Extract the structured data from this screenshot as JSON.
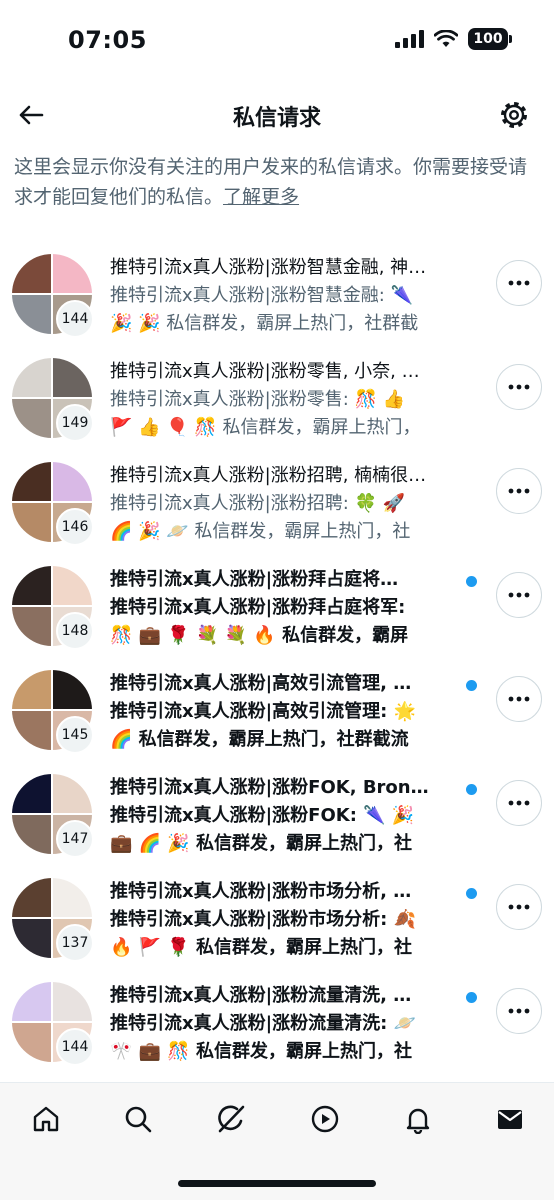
{
  "status": {
    "time": "07:05",
    "battery": "100"
  },
  "header": {
    "title": "私信请求"
  },
  "notice": {
    "text": "这里会显示你没有关注的用户发来的私信请求。你需要接受请求才能回复他们的私信。",
    "link": "了解更多"
  },
  "requests": [
    {
      "name": "推特引流x真人涨粉|涨粉智慧金融, 神…",
      "line2": "推特引流x真人涨粉|涨粉智慧金融: 🌂",
      "line3": "🎉 🎉 私信群发，霸屏上热门，社群截",
      "count": "144",
      "unread": false,
      "avatar_colors": [
        "#7b4a3a",
        "#f4b7c5",
        "#8a8f96",
        "#a89a8c"
      ]
    },
    {
      "name": "推特引流x真人涨粉|涨粉零售, 小奈, …",
      "line2": "推特引流x真人涨粉|涨粉零售: 🎊 👍",
      "line3": "🚩 👍 🎈 🎊 私信群发，霸屏上热门，",
      "count": "149",
      "unread": false,
      "avatar_colors": [
        "#d8d4cf",
        "#6b6460",
        "#9c9188",
        "#c9c2b8"
      ]
    },
    {
      "name": "推特引流x真人涨粉|涨粉招聘, 楠楠很…",
      "line2": "推特引流x真人涨粉|涨粉招聘: 🍀 🚀",
      "line3": "🌈 🎉 🪐 私信群发，霸屏上热门，社",
      "count": "146",
      "unread": false,
      "avatar_colors": [
        "#4a2e22",
        "#d9b9e6",
        "#b58a66",
        "#c7a98f"
      ]
    },
    {
      "name": "推特引流x真人涨粉|涨粉拜占庭将…",
      "line2": "推特引流x真人涨粉|涨粉拜占庭将军:",
      "line3": "🎊 💼 🌹 💐 💐 🔥 私信群发，霸屏",
      "count": "148",
      "unread": true,
      "avatar_colors": [
        "#2b2220",
        "#f1d7c9",
        "#8a6f60",
        "#e9dcd3"
      ]
    },
    {
      "name": "推特引流x真人涨粉|高效引流管理, …",
      "line2": "推特引流x真人涨粉|高效引流管理: 🌟",
      "line3": "🌈 私信群发，霸屏上热门，社群截流",
      "count": "145",
      "unread": true,
      "avatar_colors": [
        "#c79a6b",
        "#1e1a19",
        "#9b7660",
        "#d9b8a6"
      ]
    },
    {
      "name": "推特引流x真人涨粉|涨粉FOK, Bron…",
      "line2": "推特引流x真人涨粉|涨粉FOK: 🌂 🎉",
      "line3": "💼 🌈 🎉 私信群发，霸屏上热门，社",
      "count": "147",
      "unread": true,
      "avatar_colors": [
        "#0e1230",
        "#e8d5c8",
        "#7f6a5d",
        "#cbb4a4"
      ]
    },
    {
      "name": "推特引流x真人涨粉|涨粉市场分析, …",
      "line2": "推特引流x真人涨粉|涨粉市场分析: 🍂",
      "line3": "🔥 🚩 🌹 私信群发，霸屏上热门，社",
      "count": "137",
      "unread": true,
      "avatar_colors": [
        "#5b4030",
        "#f2eeea",
        "#2d2a33",
        "#e0c7b2"
      ]
    },
    {
      "name": "推特引流x真人涨粉|涨粉流量清洗, …",
      "line2": "推特引流x真人涨粉|涨粉流量清洗: 🪐",
      "line3": "🎌 💼 🎊 私信群发，霸屏上热门，社",
      "count": "144",
      "unread": true,
      "avatar_colors": [
        "#d7c8f0",
        "#e8e2e0",
        "#cfa690",
        "#efd8cc"
      ]
    }
  ],
  "icons": {
    "back": "arrow-left-icon",
    "settings": "gear-icon",
    "more": "more-horizontal-icon",
    "home": "home-icon",
    "search": "search-icon",
    "grok": "grok-icon",
    "video": "play-icon",
    "notifications": "bell-icon",
    "messages": "envelope-icon"
  },
  "colors": {
    "accent": "#1d9bf0",
    "secondary_text": "#536471"
  }
}
